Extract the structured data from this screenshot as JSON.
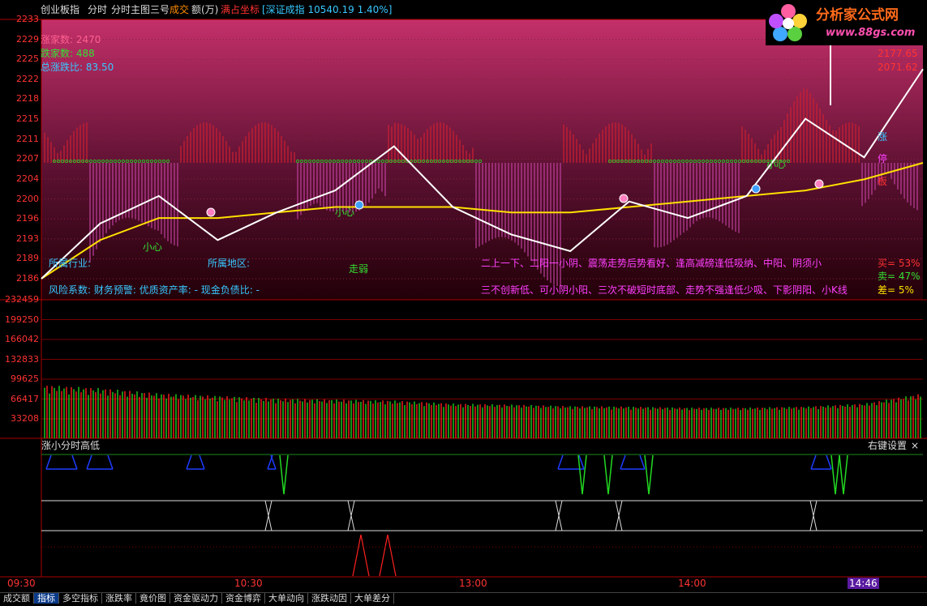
{
  "header": {
    "name": "创业板指",
    "mode": "分时",
    "template": "分时主图三号",
    "vol_label": "成交",
    "vol_unit": "额(万)",
    "coord": "满占坐标",
    "index_ref": "[深证成指 10540.19 1.40%]"
  },
  "logo": {
    "title": "分析家公式网",
    "url": "www.88gs.com"
  },
  "breadth": {
    "up": "涨家数: 2470",
    "down": "跌家数: 488",
    "ratio": "总涨跌比: 83.50"
  },
  "right_values": {
    "v1": "2177.65",
    "v2": "2071.62"
  },
  "right_labels": {
    "a": "涨",
    "b": "停",
    "c": "板"
  },
  "info": {
    "industry": "所属行业:",
    "region": "所属地区:",
    "risk": "风险系数: 财务预警: 优质资产率: - 现金负债比: -",
    "advice1": "二上一下、二阳一小阴、震荡走势后势看好、逢高减磅逢低吸纳、中阳、阴须小",
    "advice2": "三不创新低、可小阴小阳、三次不破短时底部、走势不强逢低少吸、下影阴阳、小K线",
    "buy": "买= 53%",
    "sell": "卖= 47%",
    "diff": "差= 5%"
  },
  "annotations": {
    "a1": "小心",
    "a2": "小心",
    "a3": "走弱",
    "a4": "小心"
  },
  "price_axis": [
    "2233",
    "2229",
    "2225",
    "2222",
    "2218",
    "2215",
    "2211",
    "2207",
    "2204",
    "2200",
    "2196",
    "2193",
    "2189",
    "2186"
  ],
  "vol_axis": [
    "232459",
    "199250",
    "166042",
    "132833",
    "99625",
    "66417",
    "33208"
  ],
  "time_axis": [
    "09:30",
    "10:30",
    "13:00",
    "14:00",
    "14:46"
  ],
  "sub_panel": {
    "title": "涨小分时高低",
    "settings": "右键设置",
    "close": "×"
  },
  "tabs": [
    "成交额",
    "指标",
    "多空指标",
    "涨跌率",
    "竟价图",
    "资金驱动力",
    "资金博弈",
    "大单动向",
    "涨跌动因",
    "大单差分"
  ],
  "active_tab": 1,
  "colors": {
    "price": "#ffffff",
    "avg": "#ffe000",
    "up": "#ff2020",
    "down": "#20d020",
    "grid": "#7a0000",
    "axis_text": "#ff3333",
    "blue": "#1e3cff"
  },
  "chart_data": {
    "type": "line",
    "title": "",
    "ylim": [
      2186,
      2233
    ],
    "x": [
      "09:30",
      "09:45",
      "10:00",
      "10:15",
      "10:30",
      "10:45",
      "11:00",
      "11:15",
      "11:30",
      "13:15",
      "13:30",
      "13:45",
      "14:00",
      "14:15",
      "14:30",
      "14:46"
    ],
    "series": [
      {
        "values": [
          2186,
          2196,
          2201,
          2193,
          2198,
          2202,
          2210,
          2199,
          2194,
          2191,
          2200,
          2197,
          2201,
          2215,
          2208,
          2224
        ]
      },
      {
        "values": [
          2186,
          2193,
          2197,
          2197,
          2198,
          2199,
          2199,
          2199,
          2198,
          2198,
          2199,
          2200,
          2201,
          2202,
          2204,
          2207
        ]
      }
    ],
    "volume": {
      "ylim": [
        0,
        232459
      ],
      "values": [
        66417,
        60000,
        50000,
        45000,
        40000,
        38000,
        36000,
        30000,
        28000,
        25000,
        24000,
        22000,
        22000,
        24000,
        30000,
        50000
      ]
    }
  }
}
